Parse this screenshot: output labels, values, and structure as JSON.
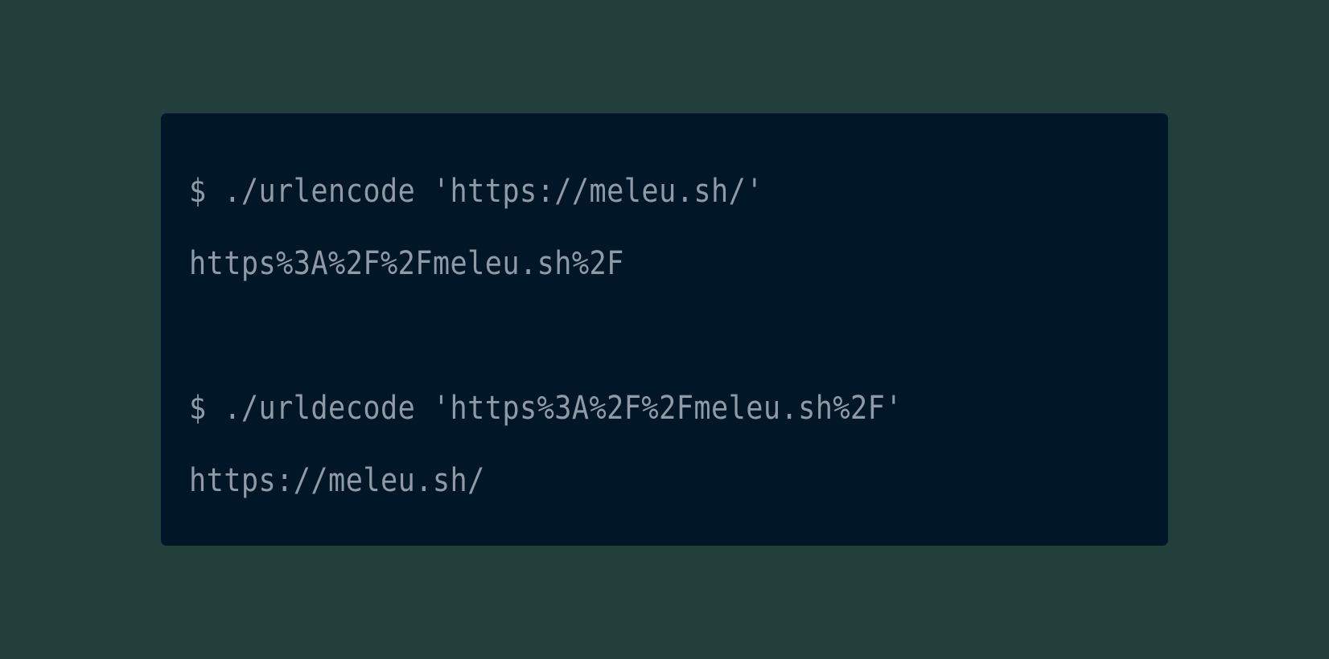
{
  "colors": {
    "background": "#233f3c",
    "terminal_background": "#011627",
    "text": "#8e9aa8"
  },
  "terminal": {
    "lines": [
      "$ ./urlencode 'https://meleu.sh/'",
      "https%3A%2F%2Fmeleu.sh%2F",
      "",
      "$ ./urldecode 'https%3A%2F%2Fmeleu.sh%2F'",
      "https://meleu.sh/"
    ]
  }
}
